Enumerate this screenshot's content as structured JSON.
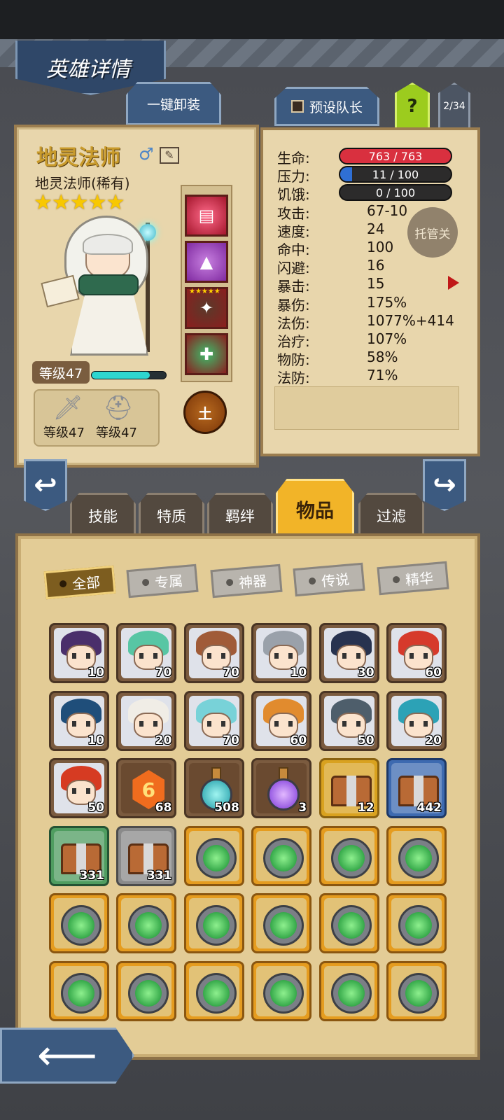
{
  "screen_title": "英雄详情",
  "buttons": {
    "unequip_all": "一键卸装",
    "preset_captain": "预设队长",
    "help": "?",
    "page_indicator": "2/34",
    "auto_manage": "托管关"
  },
  "hero": {
    "name": "地灵法师",
    "subtitle": "地灵法师(稀有)",
    "stars": "★★★★★",
    "level_label": "等级47",
    "xp_fraction": 0.78,
    "element": "土",
    "weapon_level": "等级47",
    "armor_level": "等级47",
    "equipment_star_label": "★★★★★",
    "gender_icon": "male-symbol-icon"
  },
  "stats": {
    "rows": [
      {
        "key": "生命:",
        "value": ""
      },
      {
        "key": "压力:",
        "value": ""
      },
      {
        "key": "饥饿:",
        "value": ""
      },
      {
        "key": "攻击:",
        "value": "67-10"
      },
      {
        "key": "速度:",
        "value": "24"
      },
      {
        "key": "命中:",
        "value": "100"
      },
      {
        "key": "闪避:",
        "value": "16"
      },
      {
        "key": "暴击:",
        "value": "15"
      },
      {
        "key": "暴伤:",
        "value": "175%"
      },
      {
        "key": "法伤:",
        "value": "1077%+414"
      },
      {
        "key": "治疗:",
        "value": "107%"
      },
      {
        "key": "物防:",
        "value": "58%"
      },
      {
        "key": "法防:",
        "value": "71%"
      }
    ],
    "hp": {
      "text": "763 / 763",
      "fraction": 1.0,
      "color": "#d9303f"
    },
    "stress": {
      "text": "11 / 100",
      "fraction": 0.11,
      "color": "#2f6fd4"
    },
    "hunger": {
      "text": "0 / 100",
      "fraction": 0.0,
      "color": "#777777"
    }
  },
  "tabs": [
    {
      "label": "技能",
      "active": false
    },
    {
      "label": "特质",
      "active": false
    },
    {
      "label": "羁绊",
      "active": false
    },
    {
      "label": "物品",
      "active": true
    },
    {
      "label": "过滤",
      "active": false
    }
  ],
  "filters": [
    {
      "label": "全部",
      "active": true
    },
    {
      "label": "专属",
      "active": false
    },
    {
      "label": "神器",
      "active": false
    },
    {
      "label": "传说",
      "active": false
    },
    {
      "label": "精华",
      "active": false
    }
  ],
  "inventory": {
    "rows": [
      [
        {
          "type": "hero",
          "count": "10",
          "hair": "#4a2f6b"
        },
        {
          "type": "hero",
          "count": "70",
          "hair": "#58c6a4"
        },
        {
          "type": "hero",
          "count": "70",
          "hair": "#a05b38"
        },
        {
          "type": "hero",
          "count": "10",
          "hair": "#9aa1aa"
        },
        {
          "type": "hero",
          "count": "30",
          "hair": "#27324f"
        },
        {
          "type": "hero",
          "count": "60",
          "hair": "#d63a2b"
        }
      ],
      [
        {
          "type": "hero",
          "count": "10",
          "hair": "#1f4e7a"
        },
        {
          "type": "hero",
          "count": "20",
          "hair": "#f0ede6"
        },
        {
          "type": "hero",
          "count": "70",
          "hair": "#78d2d8"
        },
        {
          "type": "hero",
          "count": "60",
          "hair": "#e18b2e"
        },
        {
          "type": "hero",
          "count": "50",
          "hair": "#4e5e6b"
        },
        {
          "type": "hero",
          "count": "20",
          "hair": "#2ca2b6"
        }
      ],
      [
        {
          "type": "hero",
          "count": "50",
          "hair": "#d63b22"
        },
        {
          "type": "rune",
          "count": "68",
          "glyph": "6"
        },
        {
          "type": "potion-teal",
          "count": "508"
        },
        {
          "type": "potion-purple",
          "count": "3"
        },
        {
          "type": "chest",
          "count": "12",
          "frame": "gold"
        },
        {
          "type": "chest",
          "count": "442",
          "frame": "blue"
        }
      ],
      [
        {
          "type": "chest",
          "count": "331",
          "frame": "green"
        },
        {
          "type": "chest",
          "count": "331",
          "frame": "grey"
        },
        {
          "type": "gem",
          "count": ""
        },
        {
          "type": "gem",
          "count": ""
        },
        {
          "type": "gem",
          "count": ""
        },
        {
          "type": "gem",
          "count": ""
        }
      ],
      [
        {
          "type": "gem",
          "count": ""
        },
        {
          "type": "gem",
          "count": ""
        },
        {
          "type": "gem",
          "count": ""
        },
        {
          "type": "gem",
          "count": ""
        },
        {
          "type": "gem",
          "count": ""
        },
        {
          "type": "gem",
          "count": ""
        }
      ],
      [
        {
          "type": "gem",
          "count": ""
        },
        {
          "type": "gem",
          "count": ""
        },
        {
          "type": "gem",
          "count": ""
        },
        {
          "type": "gem",
          "count": ""
        },
        {
          "type": "gem",
          "count": ""
        },
        {
          "type": "gem",
          "count": ""
        }
      ]
    ]
  },
  "icons": {
    "prev_hero": "return-left-icon",
    "next_hero": "return-right-icon",
    "back": "back-arrow-icon"
  }
}
